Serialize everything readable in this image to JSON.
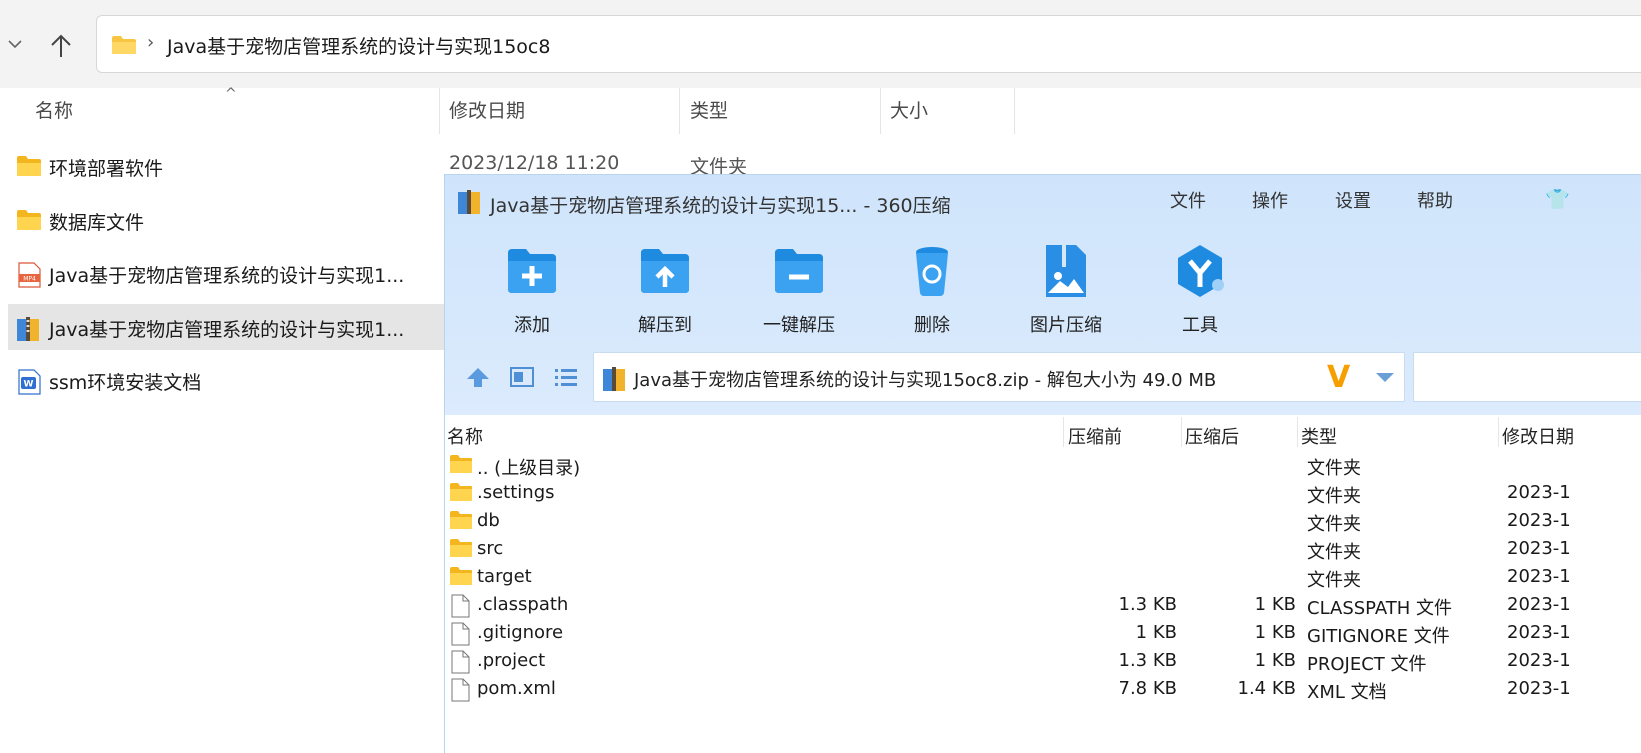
{
  "explorer": {
    "address": {
      "path_segment": "Java基于宠物店管理系统的设计与实现15oc8"
    },
    "columns": {
      "name": "名称",
      "modified": "修改日期",
      "type": "类型",
      "size": "大小"
    },
    "partial_row": {
      "modified": "2023/12/18 11:20",
      "type": "文件夹"
    },
    "files": [
      {
        "name": "环境部署软件",
        "icon": "folder-icon"
      },
      {
        "name": "数据库文件",
        "icon": "folder-icon"
      },
      {
        "name": "Java基于宠物店管理系统的设计与实现1...",
        "icon": "mp4-file-icon"
      },
      {
        "name": "Java基于宠物店管理系统的设计与实现1...",
        "icon": "zip-archive-icon",
        "selected": true
      },
      {
        "name": "ssm环境安装文档",
        "icon": "word-doc-icon"
      }
    ]
  },
  "zip_window": {
    "title": "Java基于宠物店管理系统的设计与实现15... - 360压缩",
    "menu": [
      "文件",
      "操作",
      "设置",
      "帮助"
    ],
    "toolbar": [
      {
        "label": "添加",
        "icon": "add-icon"
      },
      {
        "label": "解压到",
        "icon": "extract-to-icon"
      },
      {
        "label": "一键解压",
        "icon": "one-click-extract-icon"
      },
      {
        "label": "删除",
        "icon": "delete-icon"
      },
      {
        "label": "图片压缩",
        "icon": "image-compress-icon"
      },
      {
        "label": "工具",
        "icon": "tools-icon"
      }
    ],
    "path_bar": {
      "text": "Java基于宠物店管理系统的设计与实现15oc8.zip - 解包大小为 49.0 MB"
    },
    "columns": {
      "name": "名称",
      "before": "压缩前",
      "after": "压缩后",
      "type": "类型",
      "modified": "修改日期"
    },
    "rows": [
      {
        "name": ".. (上级目录)",
        "kind": "folder",
        "before": "",
        "after": "",
        "type": "文件夹",
        "date": ""
      },
      {
        "name": ".settings",
        "kind": "folder",
        "before": "",
        "after": "",
        "type": "文件夹",
        "date": "2023-1"
      },
      {
        "name": "db",
        "kind": "folder",
        "before": "",
        "after": "",
        "type": "文件夹",
        "date": "2023-1"
      },
      {
        "name": "src",
        "kind": "folder",
        "before": "",
        "after": "",
        "type": "文件夹",
        "date": "2023-1"
      },
      {
        "name": "target",
        "kind": "folder",
        "before": "",
        "after": "",
        "type": "文件夹",
        "date": "2023-1"
      },
      {
        "name": ".classpath",
        "kind": "file",
        "before": "1.3 KB",
        "after": "1 KB",
        "type": "CLASSPATH 文件",
        "date": "2023-1"
      },
      {
        "name": ".gitignore",
        "kind": "file",
        "before": "1 KB",
        "after": "1 KB",
        "type": "GITIGNORE 文件",
        "date": "2023-1"
      },
      {
        "name": ".project",
        "kind": "file",
        "before": "1.3 KB",
        "after": "1 KB",
        "type": "PROJECT 文件",
        "date": "2023-1"
      },
      {
        "name": "pom.xml",
        "kind": "file",
        "before": "7.8 KB",
        "after": "1.4 KB",
        "type": "XML 文档",
        "date": "2023-1"
      }
    ]
  }
}
